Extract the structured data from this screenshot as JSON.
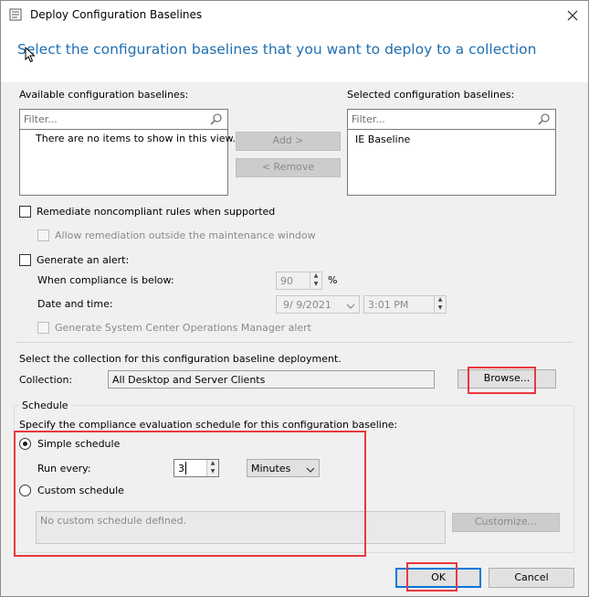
{
  "window": {
    "title": "Deploy Configuration Baselines",
    "heading": "Select the configuration baselines that you want to deploy to a collection"
  },
  "available": {
    "label": "Available configuration baselines:",
    "filter_placeholder": "Filter...",
    "empty_message": "There are no items to show in this view."
  },
  "selected": {
    "label": "Selected configuration baselines:",
    "filter_placeholder": "Filter...",
    "items": [
      "IE Baseline"
    ]
  },
  "buttons": {
    "add": "Add >",
    "remove": "< Remove",
    "browse": "Browse...",
    "customize": "Customize...",
    "ok": "OK",
    "cancel": "Cancel"
  },
  "options": {
    "remediate": "Remediate noncompliant rules when supported",
    "allow_remediation": "Allow remediation outside the maintenance window",
    "generate_alert": "Generate an alert:",
    "compliance_label": "When compliance is below:",
    "compliance_value": "90",
    "compliance_unit": "%",
    "datetime_label": "Date and time:",
    "date_value": "9/ 9/2021",
    "time_value": "3:01 PM",
    "scom_alert": "Generate System Center Operations Manager alert"
  },
  "collection": {
    "intro": "Select the collection for this configuration baseline deployment.",
    "label": "Collection:",
    "value": "All Desktop and Server Clients"
  },
  "schedule": {
    "group_label": "Schedule",
    "intro": "Specify the compliance evaluation schedule for this configuration baseline:",
    "simple_label": "Simple schedule",
    "run_every_label": "Run every:",
    "run_every_value": "3",
    "unit_value": "Minutes",
    "custom_label": "Custom schedule",
    "custom_text": "No custom schedule defined."
  },
  "colors": {
    "heading": "#1f6fb2",
    "highlight_box": "#e8383d",
    "ok_border": "#0078d7"
  }
}
